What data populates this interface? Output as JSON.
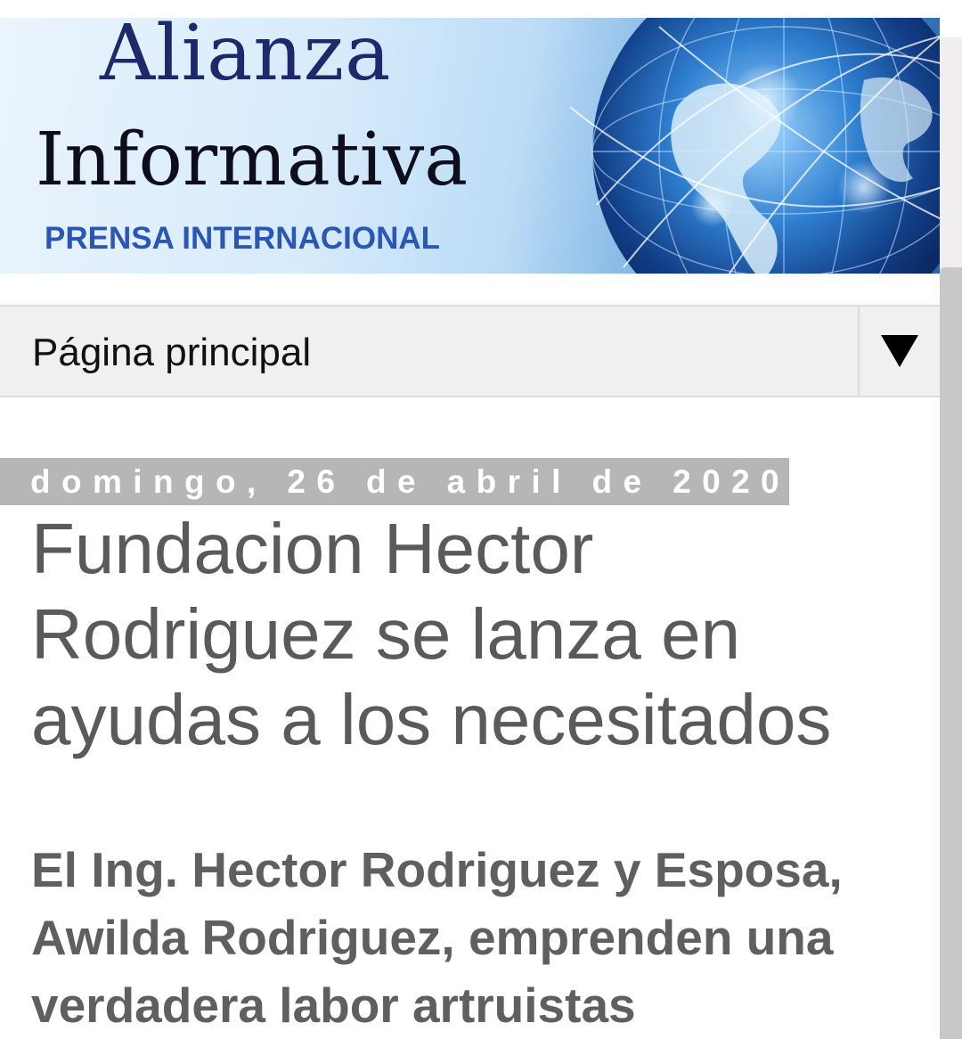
{
  "header": {
    "title_line1": "Alianza",
    "title_line2": "Informativa",
    "tagline": "PRENSA INTERNACIONAL",
    "colors": {
      "title_line1": "#1c2a6b",
      "title_line2": "#0d0d1e",
      "tagline": "#2b56b6"
    },
    "image_icon": "globe-network-icon"
  },
  "nav": {
    "label": "Página principal",
    "dropdown_icon": "triangle-down-icon"
  },
  "post": {
    "date": "domingo, 26 de abril de 2020",
    "title": "Fundacion Hector Rodriguez se lanza en ayudas a los necesitados",
    "subtitle": "El Ing. Hector Rodriguez y Esposa, Awilda Rodriguez, emprenden una verdadera labor artruistas"
  }
}
